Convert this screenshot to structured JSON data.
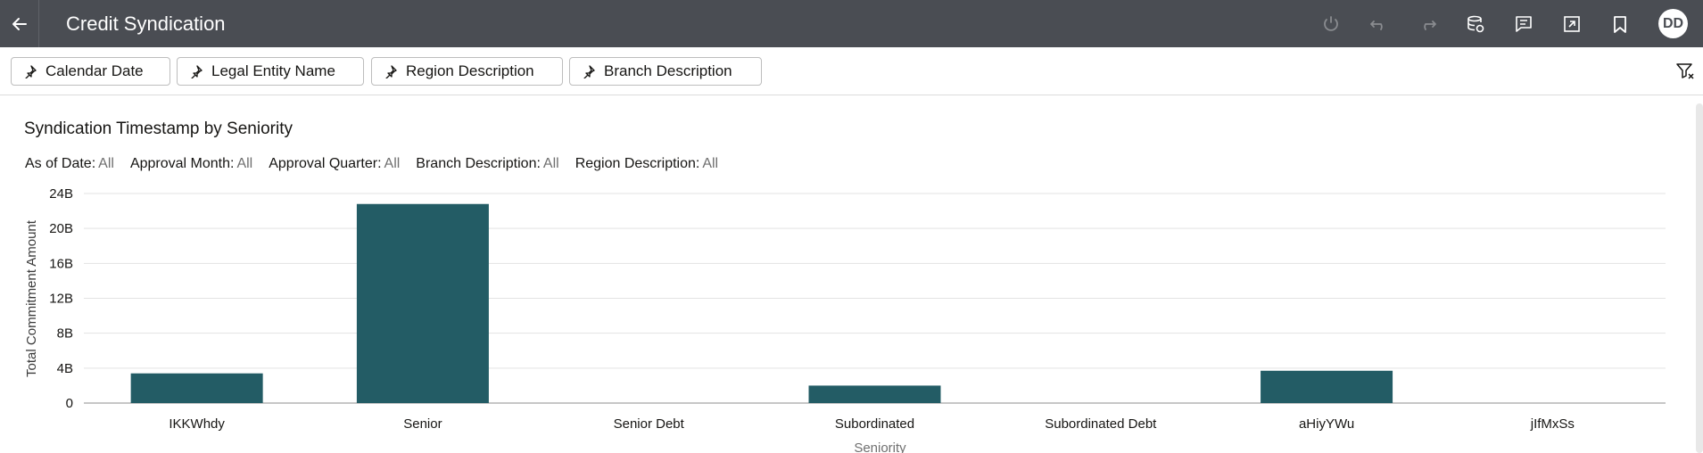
{
  "header": {
    "title": "Credit Syndication",
    "avatar_initials": "DD",
    "icons": [
      "back-arrow-icon",
      "refresh-icon",
      "undo-icon",
      "redo-icon",
      "data-refresh-icon",
      "comments-icon",
      "present-icon",
      "bookmark-icon"
    ]
  },
  "filterbar": {
    "pills": [
      {
        "label": "Calendar Date"
      },
      {
        "label": "Legal Entity Name"
      },
      {
        "label": "Region Description"
      },
      {
        "label": "Branch Description"
      }
    ]
  },
  "visualization": {
    "title": "Syndication Timestamp by Seniority",
    "filters": [
      {
        "name": "As of Date:",
        "value": "All"
      },
      {
        "name": "Approval Month:",
        "value": "All"
      },
      {
        "name": "Approval Quarter:",
        "value": "All"
      },
      {
        "name": "Branch Description:",
        "value": "All"
      },
      {
        "name": "Region Description:",
        "value": "All"
      }
    ]
  },
  "chart_data": {
    "type": "bar",
    "title": "Syndication Timestamp by Seniority",
    "xlabel": "Seniority",
    "ylabel": "Total Commitment Amount",
    "categories": [
      "IKKWhdy",
      "Senior",
      "Senior Debt",
      "Subordinated",
      "Subordinated Debt",
      "aHiyYWu",
      "jIfMxSs"
    ],
    "values": [
      3400000000,
      22800000000,
      0,
      2000000000,
      0,
      3700000000,
      0
    ],
    "ylim": [
      0,
      24000000000
    ],
    "yticks": [
      {
        "value": 0,
        "label": "0"
      },
      {
        "value": 4000000000,
        "label": "4B"
      },
      {
        "value": 8000000000,
        "label": "8B"
      },
      {
        "value": 12000000000,
        "label": "12B"
      },
      {
        "value": 16000000000,
        "label": "16B"
      },
      {
        "value": 20000000000,
        "label": "20B"
      },
      {
        "value": 24000000000,
        "label": "24B"
      }
    ],
    "grid": true,
    "bar_color": "#235c65"
  }
}
